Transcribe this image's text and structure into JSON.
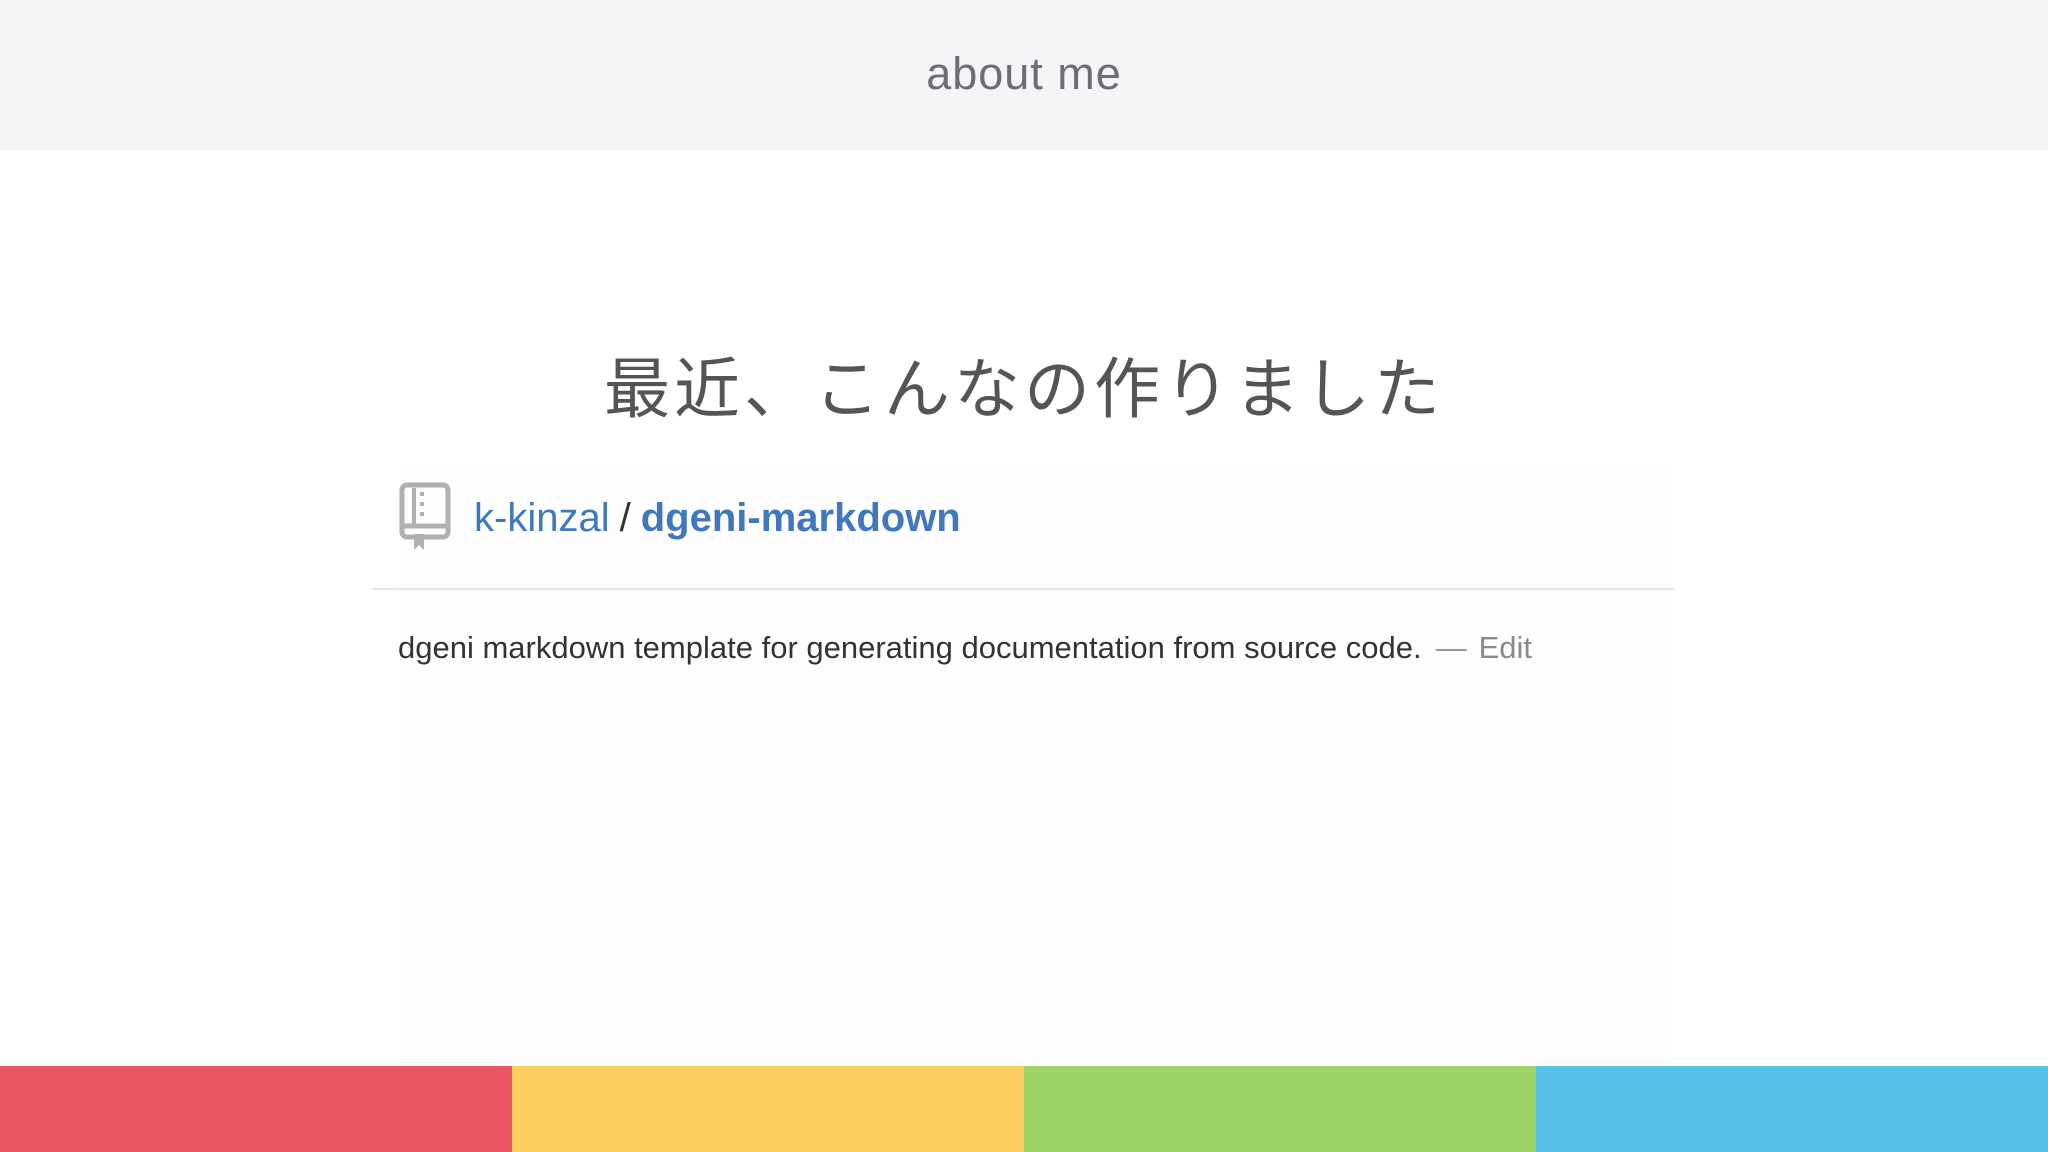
{
  "header": {
    "title": "about me"
  },
  "main": {
    "heading": "最近、こんなの作りました"
  },
  "repo": {
    "icon": "repo-book-icon",
    "owner": "k-kinzal",
    "separator": "/",
    "name": "dgeni-markdown",
    "description": "dgeni markdown template for generating documentation from source code.",
    "dash": "—",
    "edit_label": "Edit"
  },
  "footer_colors": [
    "#ec5565",
    "#fccd60",
    "#a0d469",
    "#55bfe7"
  ]
}
